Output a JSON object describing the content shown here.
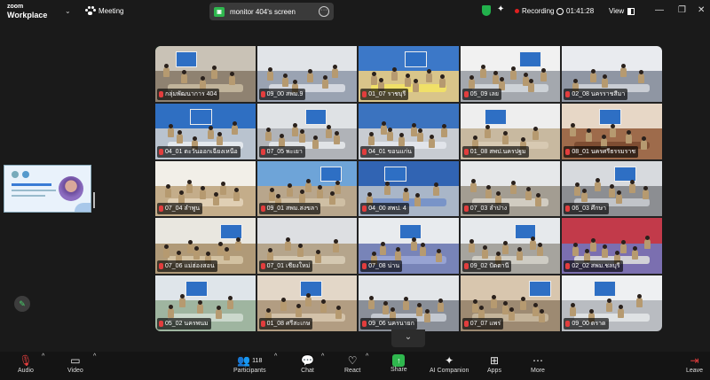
{
  "app": {
    "logo_top": "zoom",
    "logo_bottom": "Workplace"
  },
  "header": {
    "meeting_label": "Meeting",
    "shared_screen_label": "monitor 404's screen",
    "recording_label": "Recording",
    "timer": "01:41:28",
    "view_label": "View"
  },
  "gallery": {
    "tiles": [
      {
        "name": "กลุ่มพัฒนาการ 404",
        "active": true,
        "wall": "#c9c2b6",
        "floor": "#8f8271",
        "table": "#c7b9a0"
      },
      {
        "name": "09_00 สพม.9",
        "wall": "#e1e4e8",
        "floor": "#9aa3b2",
        "table": "#d9dde3"
      },
      {
        "name": "01_07 ราชบุรี",
        "wall": "#3c78c8",
        "floor": "#d9c58a",
        "table": "#f2e264"
      },
      {
        "name": "05_09 เลย",
        "wall": "#f1f1f1",
        "floor": "#a4a8ae",
        "table": "#d2d6dc"
      },
      {
        "name": "02_08 นครราชสีมา",
        "wall": "#e9ebef",
        "floor": "#8f96a3",
        "table": "#cfd3d9"
      },
      {
        "name": "04_01 ตะวันออกเฉียงเหนือ",
        "wall": "#2f6fc2",
        "floor": "#b9c3cf",
        "table": "#e8ecf0"
      },
      {
        "name": "07_05 พะเยา",
        "wall": "#dfe2e5",
        "floor": "#b0b3b8",
        "table": "#e5e8eb"
      },
      {
        "name": "04_01 ขอนแก่น",
        "wall": "#3b73bf",
        "floor": "#c8ccd2",
        "table": "#e3e7ec"
      },
      {
        "name": "01_08 สพป.นครปฐม",
        "wall": "#eeeeee",
        "floor": "#c8b9a0",
        "table": "#d8cbb4"
      },
      {
        "name": "08_01 นครศรีธรรมราช",
        "wall": "#e7d7c6",
        "floor": "#9e6b4b",
        "table": "#7a4a30"
      },
      {
        "name": "07_04 ลำพูน",
        "wall": "#f2efe8",
        "floor": "#c4ad8a",
        "table": "#e3d3b8"
      },
      {
        "name": "09_01 สพม.สงขลา",
        "wall": "#6ea4d8",
        "floor": "#b8a68c",
        "table": "#d2c2a6"
      },
      {
        "name": "04_00 สพป. 4",
        "wall": "#3164b3",
        "floor": "#a9b6c8",
        "table": "#7390c8"
      },
      {
        "name": "07_03 ลำปาง",
        "wall": "#e6e8ea",
        "floor": "#a39d92",
        "table": "#d6d1c6"
      },
      {
        "name": "06_03 ศึกษา",
        "wall": "#d7dade",
        "floor": "#8c8e92",
        "table": "#c7cacf"
      },
      {
        "name": "07_06 แม่ฮ่องสอน",
        "wall": "#e9e7e0",
        "floor": "#b09a78",
        "table": "#d6c5a5"
      },
      {
        "name": "07_01 เชียงใหม่",
        "wall": "#dddfe2",
        "floor": "#b5a58c",
        "table": "#d7ccb5"
      },
      {
        "name": "07_08 น่าน",
        "wall": "#e8ebee",
        "floor": "#7884b8",
        "table": "#9aa6d6"
      },
      {
        "name": "09_02 ปัตตานี",
        "wall": "#e6e9ec",
        "floor": "#a6a49e",
        "table": "#d3d0c8"
      },
      {
        "name": "02_02 สพม.ชลบุรี",
        "wall": "#c23a4a",
        "floor": "#7b6fb0",
        "table": "#dcdcdc"
      },
      {
        "name": "05_02 นครพนม",
        "wall": "#dfe5ea",
        "floor": "#9fb5a0",
        "table": "#cfdcd0"
      },
      {
        "name": "01_08 ศรีสะเกษ",
        "wall": "#e3d7c8",
        "floor": "#b29d82",
        "table": "#d6c6ad"
      },
      {
        "name": "09_06 นครนายก",
        "wall": "#e3e6e9",
        "floor": "#8a8f98",
        "table": "#c9ced6"
      },
      {
        "name": "07_07 แพร่",
        "wall": "#d8c6ae",
        "floor": "#9d8a72",
        "table": "#c9b89e"
      },
      {
        "name": "09_00 ตราด",
        "wall": "#eef0f2",
        "floor": "#b9bcc1",
        "table": "#e3e5e8"
      }
    ]
  },
  "toolbar": {
    "audio": "Audio",
    "video": "Video",
    "participants": "Participants",
    "participants_count": "118",
    "chat": "Chat",
    "react": "React",
    "share": "Share",
    "ai": "AI Companion",
    "apps": "Apps",
    "more": "More",
    "leave": "Leave"
  },
  "icons": {
    "paw": "paw-icon",
    "shield": "shield-icon",
    "sparkle": "sparkle-icon",
    "clock": "clock-icon",
    "grid": "grid-icon",
    "mic": "mic-muted-icon",
    "camera": "camera-icon",
    "people": "people-icon",
    "chat": "chat-icon",
    "heart": "heart-icon",
    "share": "share-arrow-icon",
    "apps": "apps-icon",
    "more": "more-icon",
    "leave": "leave-icon",
    "pencil": "pencil-icon"
  },
  "colors": {
    "accent_green": "#2fb74e",
    "recording_red": "#e02020",
    "muted_red": "#e23d3d"
  }
}
